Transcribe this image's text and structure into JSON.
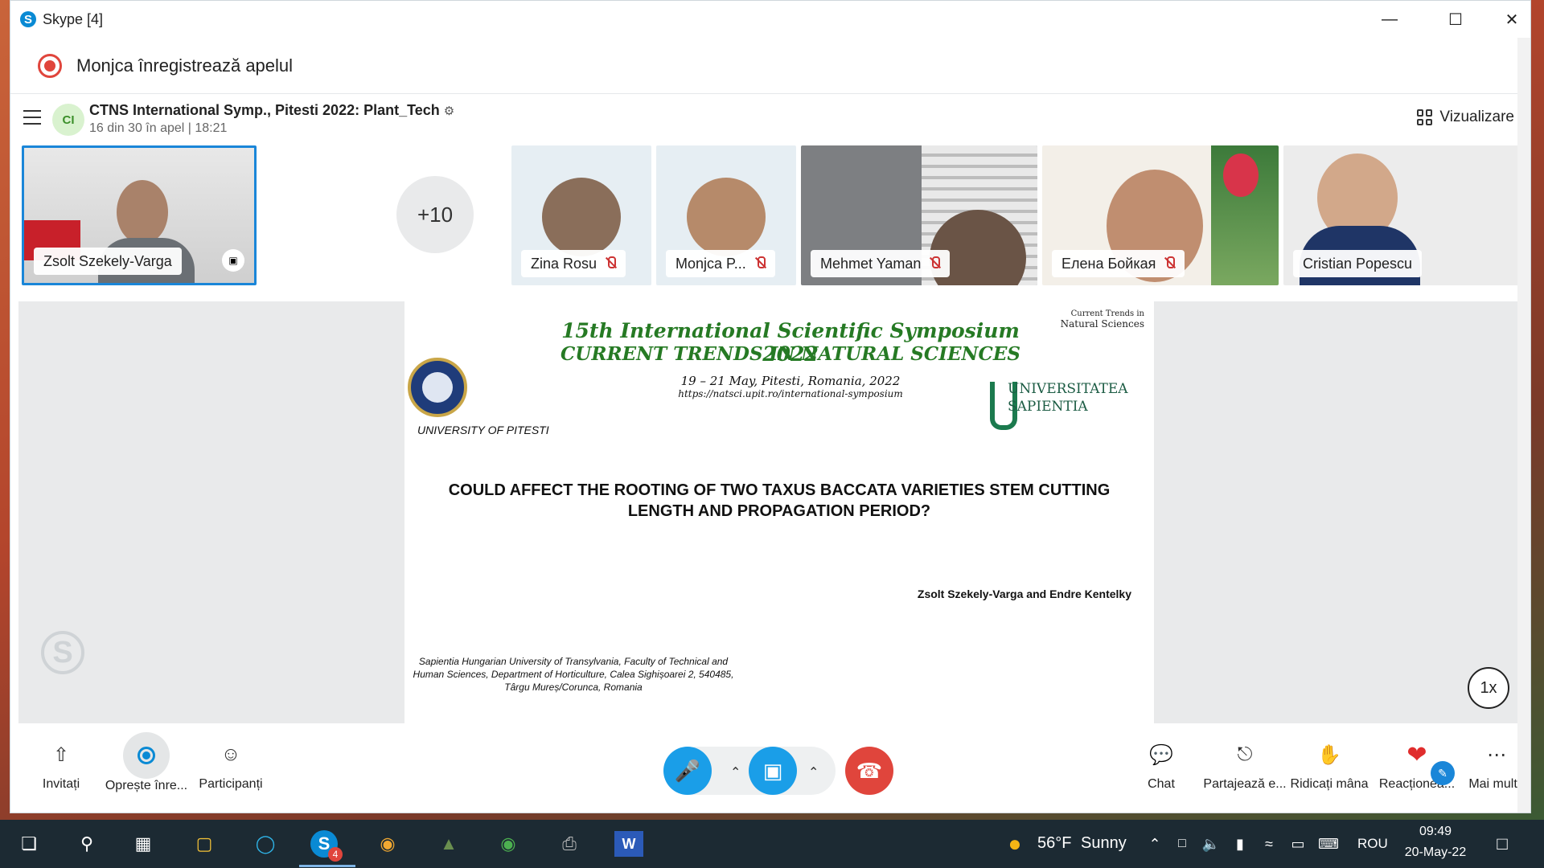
{
  "window": {
    "title": "Skype [4]"
  },
  "recording": {
    "text": "Monjca înregistrează apelul"
  },
  "call": {
    "avatar_initials": "CI",
    "title": "CTNS International Symp., Pitesti 2022: Plant_Tech",
    "subtitle": "16 din 30 în apel | 18:21",
    "view_label": "Vizualizare"
  },
  "participants": {
    "self_name": "Zsolt Szekely-Varga",
    "overflow": "+10",
    "tiles": [
      {
        "name": "Zina Rosu"
      },
      {
        "name": "Monjca P..."
      },
      {
        "name": "Mehmet Yaman"
      },
      {
        "name": "Елена Бойкая"
      },
      {
        "name": "Cristian Popescu"
      }
    ]
  },
  "slide": {
    "heading1": "15th International Scientific Symposium 2022",
    "heading2": "CURRENT TRENDS IN NATURAL SCIENCES",
    "dates": "19 – 21 May, Pitesti, Romania, 2022",
    "url": "https://natsci.upit.ro/international-symposium",
    "university_left": "UNIVERSITY OF PITESTI",
    "ctns_logo_line1": "Current Trends in",
    "ctns_logo_line2": "Natural Sciences",
    "sapientia_line1": "UNIVERSITATEA",
    "sapientia_line2": "SAPIENTIA",
    "title": "COULD AFFECT THE ROOTING OF TWO TAXUS BACCATA VARIETIES STEM CUTTING LENGTH AND PROPAGATION PERIOD?",
    "authors": "Zsolt Szekely-Varga and Endre Kentelky",
    "affiliation": "Sapientia Hungarian University of Transylvania, Faculty of Technical and Human Sciences, Department of Horticulture, Calea Sighișoarei 2, 540485, Târgu Mureș/Corunca, Romania"
  },
  "stage": {
    "speed": "1x"
  },
  "controls": {
    "invite": "Invitați",
    "stop_recording": "Oprește înre...",
    "participants": "Participanți",
    "chat": "Chat",
    "share": "Partajează e...",
    "raise_hand": "Ridicați mâna",
    "react": "Reacționea...",
    "more": "Mai multe"
  },
  "taskbar": {
    "weather_temp": "56°F",
    "weather_text": "Sunny",
    "language": "ROU",
    "time": "09:49",
    "date": "20-May-22",
    "skype_badge": "4"
  },
  "colors": {
    "skype_blue": "#0a8ad4",
    "hangup_red": "#e0453c",
    "slide_green": "#267a24"
  }
}
